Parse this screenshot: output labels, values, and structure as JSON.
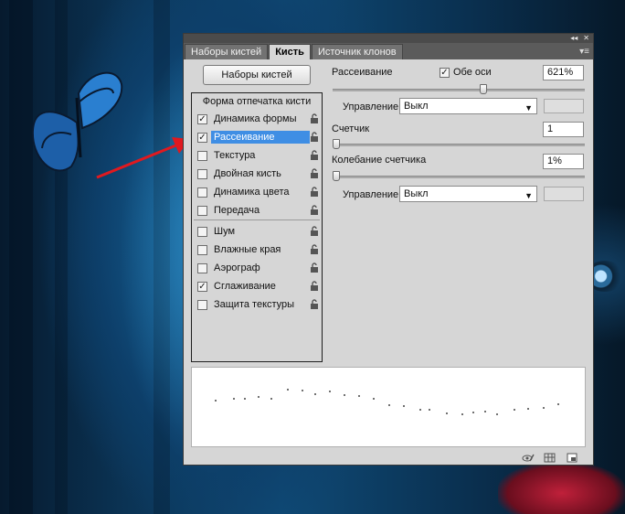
{
  "tabs": [
    {
      "label": "Наборы кистей"
    },
    {
      "label": "Кисть"
    },
    {
      "label": "Источник клонов"
    }
  ],
  "topbar": {
    "collapse": "◂◂",
    "close": "✕"
  },
  "presets_button": "Наборы кистей",
  "list": {
    "header": "Форма отпечатка кисти",
    "group1": [
      {
        "label": "Динамика формы",
        "checked": "✓"
      },
      {
        "label": "Рассеивание",
        "checked": "✓"
      },
      {
        "label": "Текстура",
        "checked": ""
      },
      {
        "label": "Двойная кисть",
        "checked": ""
      },
      {
        "label": "Динамика цвета",
        "checked": ""
      },
      {
        "label": "Передача",
        "checked": ""
      }
    ],
    "group2": [
      {
        "label": "Шум",
        "checked": ""
      },
      {
        "label": "Влажные края",
        "checked": ""
      },
      {
        "label": "Аэрограф",
        "checked": ""
      },
      {
        "label": "Сглаживание",
        "checked": "✓"
      },
      {
        "label": "Защита текстуры",
        "checked": ""
      }
    ]
  },
  "scatter": {
    "label": "Рассеивание",
    "both_axes_label": "Обе оси",
    "both_axes_checked": "✓",
    "value": "621%",
    "slider_level": 0.6
  },
  "control1": {
    "label": "Управление:",
    "value": "Выкл"
  },
  "count": {
    "label": "Счетчик",
    "value": "1",
    "slider_level": 0.0
  },
  "count_jitter": {
    "label": "Колебание счетчика",
    "value": "1%",
    "slider_level": 0.0
  },
  "control2": {
    "label": "Управление:",
    "value": "Выкл"
  },
  "icons": {
    "caret": "▼",
    "panel_menu": "▾≡"
  },
  "colors": {
    "selection": "#3f8ee4",
    "arrow": "#e0191f"
  }
}
